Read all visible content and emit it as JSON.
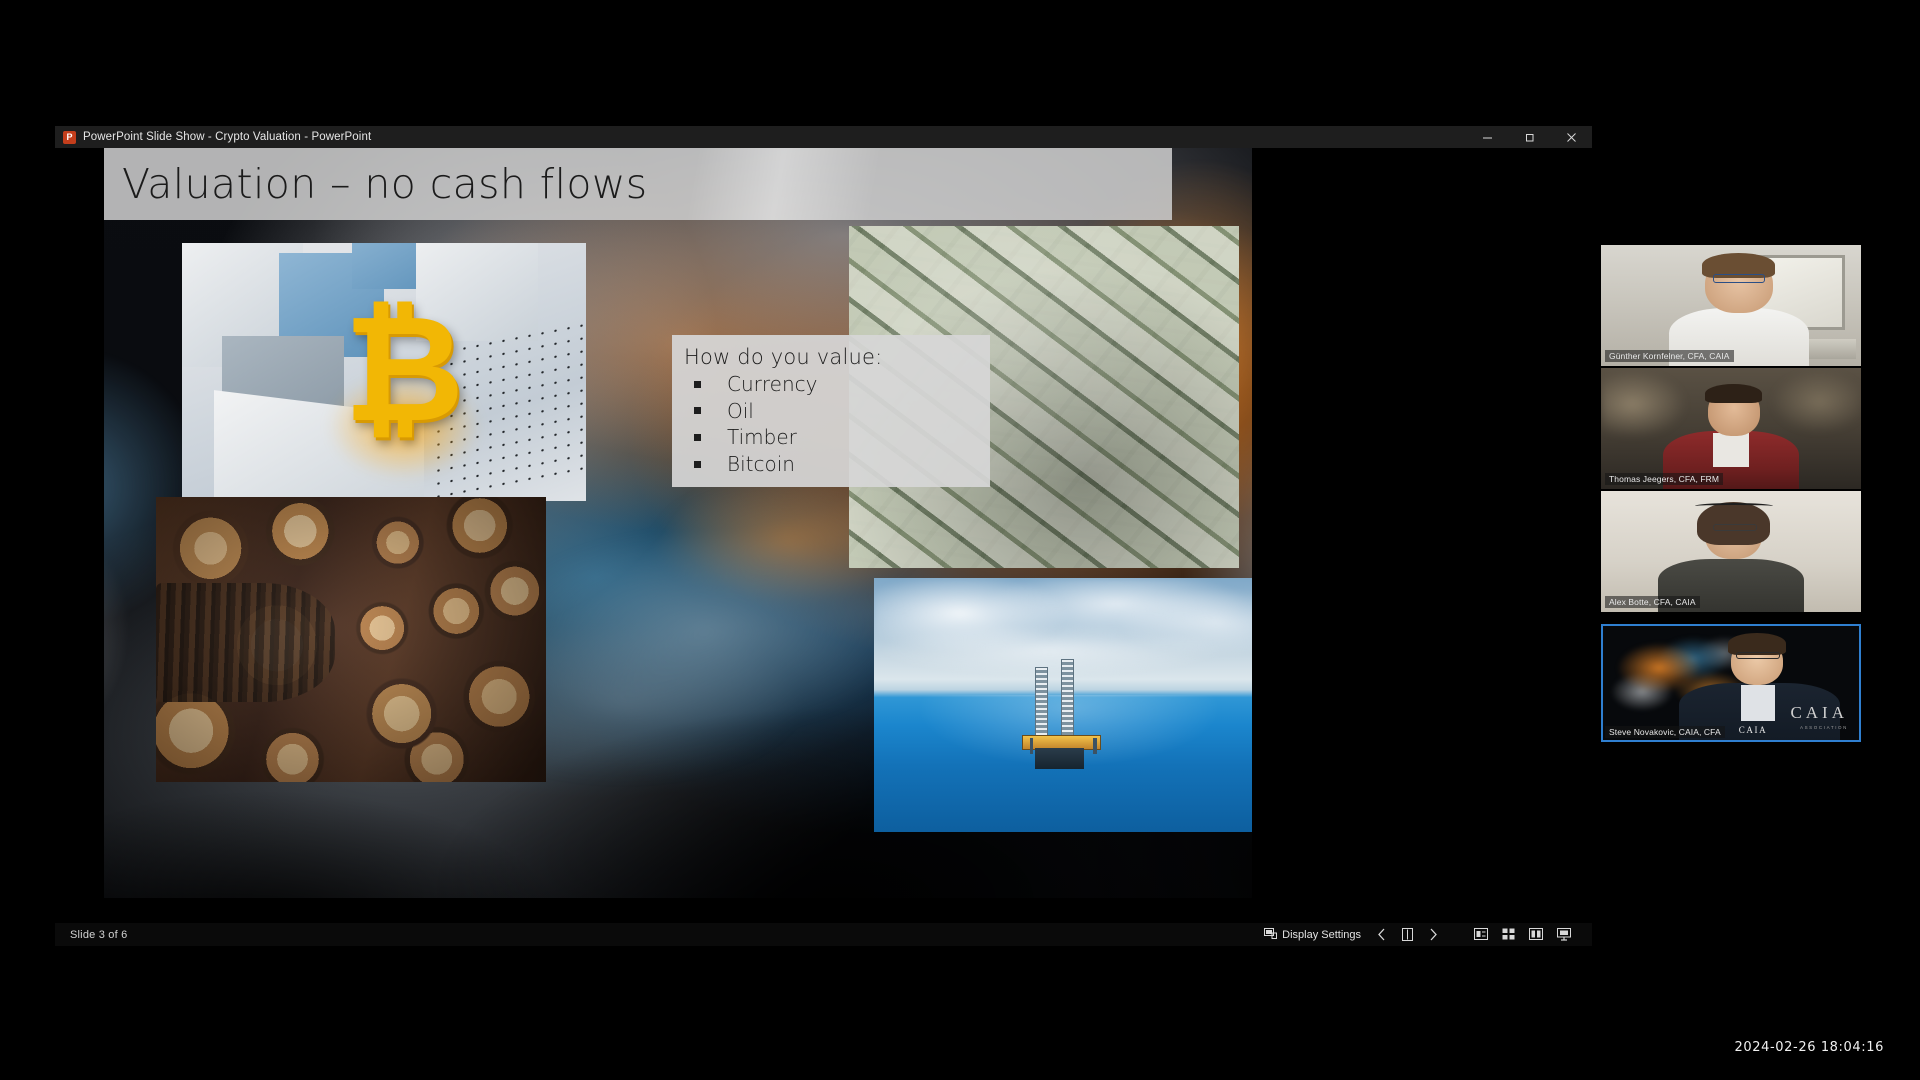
{
  "window": {
    "app_icon": "powerpoint-icon",
    "title": "PowerPoint Slide Show  -  Crypto Valuation - PowerPoint",
    "controls": {
      "minimize": "minimize-icon",
      "restore": "restore-icon",
      "close": "close-icon"
    }
  },
  "slide": {
    "title": "Valuation – no cash flows",
    "value_box": {
      "heading": "How do you value:",
      "items": [
        "Currency",
        "Oil",
        "Timber",
        "Bitcoin"
      ]
    },
    "pictures": [
      {
        "name": "bitcoin-image",
        "caption": "Gold Bitcoin symbol on concrete blocks"
      },
      {
        "name": "money-image",
        "caption": "Pile of US dollar banknotes"
      },
      {
        "name": "timber-image",
        "caption": "Stacked cut timber logs"
      },
      {
        "name": "oil-rig-image",
        "caption": "Offshore oil rig on blue ocean"
      }
    ]
  },
  "statusbar": {
    "slide_counter": "Slide 3 of 6",
    "display_settings_label": "Display Settings",
    "controls": [
      {
        "name": "previous-slide-button",
        "icon": "chevron-left-icon"
      },
      {
        "name": "pen-tools-button",
        "icon": "pen-panel-icon"
      },
      {
        "name": "next-slide-button",
        "icon": "chevron-right-icon"
      },
      {
        "name": "subtitles-button",
        "icon": "subtitles-icon"
      },
      {
        "name": "all-slides-button",
        "icon": "grid-icon"
      },
      {
        "name": "zoom-slide-button",
        "icon": "magnify-slide-icon"
      },
      {
        "name": "presenter-view-button",
        "icon": "presenter-view-icon"
      }
    ]
  },
  "participants": [
    {
      "name": "Günther Kornfelner, CFA, CAIA",
      "active": false
    },
    {
      "name": "Thomas Jeegers, CFA, FRM",
      "active": false
    },
    {
      "name": "Alex Botte, CFA, CAIA",
      "active": false
    },
    {
      "name": "Steve Novakovic, CAIA, CFA",
      "active": true
    }
  ],
  "branding": {
    "logo_text": "CAIA",
    "logo_sub": "ASSOCIATION",
    "chest_logo": "CAIA"
  },
  "timestamp": "2024-02-26  18:04:16",
  "colors": {
    "accent_active_border": "#2f7fd0",
    "powerpoint_orange": "#c43e1c",
    "title_band": "#cbcbcb"
  }
}
